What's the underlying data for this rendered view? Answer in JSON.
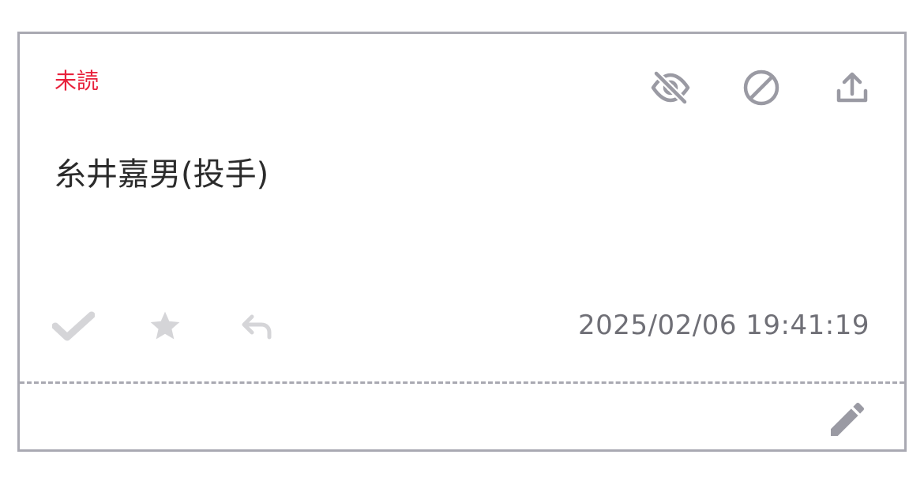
{
  "card": {
    "status_label": "未読",
    "title": "糸井嘉男(投手)",
    "timestamp": "2025/02/06 19:41:19"
  },
  "icons": {
    "hide": "eye-slash-icon",
    "block": "block-icon",
    "share": "upload-icon",
    "check": "check-icon",
    "star": "star-icon",
    "reply": "reply-icon",
    "edit": "pencil-icon"
  },
  "colors": {
    "unread": "#e8213b",
    "header_icon": "#9a9aa3",
    "action_icon": "#d5d5d8",
    "timestamp": "#6f6f76",
    "border": "#a9a9b2"
  }
}
